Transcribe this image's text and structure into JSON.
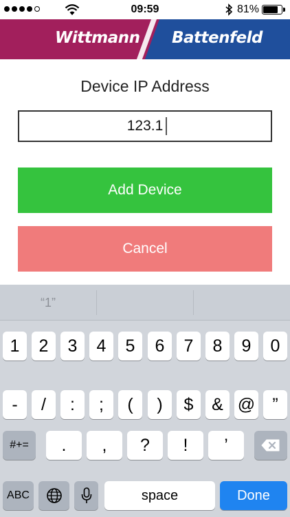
{
  "status": {
    "signal_dots": 5,
    "signal_filled": 4,
    "time": "09:59",
    "battery_percent": "81%",
    "battery_level": 0.81
  },
  "brand": {
    "left": "Wittmann",
    "right": "Battenfeld",
    "colors": {
      "left": "#a21f5c",
      "right": "#1f4f9c"
    }
  },
  "form": {
    "title": "Device IP Address",
    "ip_value": "123.1",
    "add_label": "Add Device",
    "cancel_label": "Cancel"
  },
  "keyboard": {
    "suggestion": "“1”",
    "row1": [
      "1",
      "2",
      "3",
      "4",
      "5",
      "6",
      "7",
      "8",
      "9",
      "0"
    ],
    "row2": [
      "-",
      "/",
      ":",
      ";",
      "(",
      ")",
      "$",
      "&",
      "@",
      "”"
    ],
    "row3": {
      "toggle": "#+=",
      "keys": [
        ".",
        ",",
        "?",
        "!",
        "’"
      ],
      "delete_icon": "backspace-icon"
    },
    "row4": {
      "abc": "ABC",
      "globe_icon": "globe-icon",
      "mic_icon": "microphone-icon",
      "space": "space",
      "done": "Done"
    }
  }
}
